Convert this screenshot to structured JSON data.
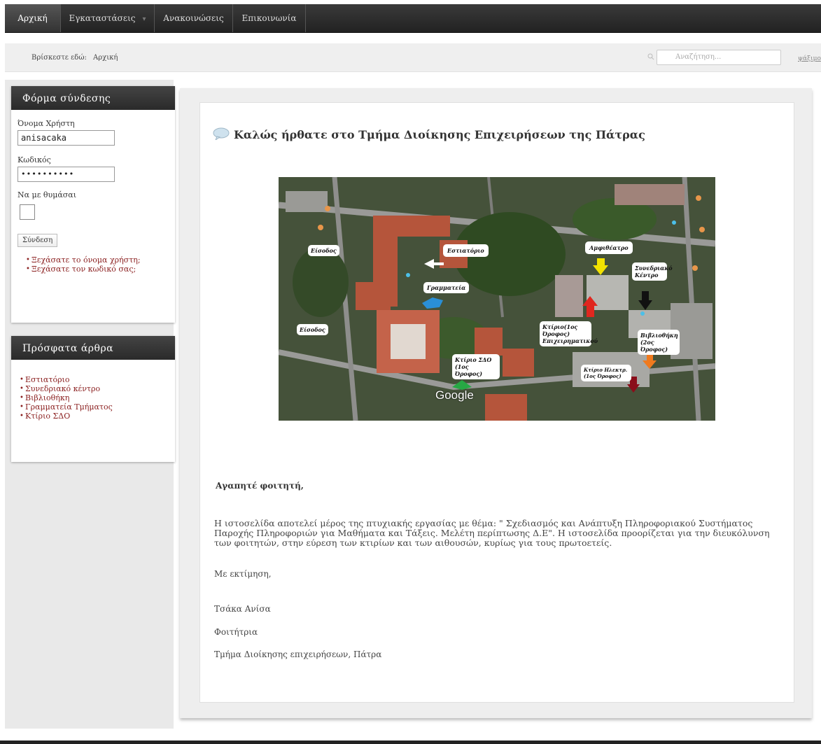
{
  "nav": {
    "items": [
      {
        "label": "Αρχική"
      },
      {
        "label": "Εγκαταστάσεις"
      },
      {
        "label": "Ανακοινώσεις"
      },
      {
        "label": "Επικοινωνία"
      }
    ]
  },
  "breadcrumb": {
    "prefix": "Βρίσκεστε εδώ:",
    "current": "Αρχική"
  },
  "search": {
    "placeholder": "Αναζήτηση...",
    "button_label": "ψάξιμο"
  },
  "login": {
    "title": "Φόρμα σύνδεσης",
    "username_label": "Όνομα Χρήστη",
    "username_value": "anisacaka",
    "password_label": "Κωδικός",
    "password_value": "••••••••••",
    "remember_label": "Να με θυμάσαι",
    "submit_label": "Σύνδεση",
    "links": [
      "Ξεχάσατε το όνομα χρήστη;",
      "Ξεχάσατε τον κωδικό σας;"
    ]
  },
  "recent": {
    "title": "Πρόσφατα άρθρα",
    "items": [
      "Εστιατόριο",
      "Συνεδριακό κέντρο",
      "Βιβλιοθήκη",
      "Γραμματεία Τμήματος",
      "Κτίριο ΣΔΟ"
    ]
  },
  "article": {
    "title": "Καλώς ήρθατε στο Τμήμα Διοίκησης Επιχειρήσεων της Πάτρας",
    "greeting": "Αγαπητέ φοιτητή,",
    "paragraph": "Η ιστοσελίδα αποτελεί μέρος της πτυχιακής εργασίας με θέμα: \" Σχεδιασμός και Ανάπτυξη Πληροφοριακού Συστήματος Παροχής Πληροφοριών για Μαθήματα και Τάξεις. Μελέτη περίπτωσης Δ.Ε\". Η ιστοσελίδα προορίζεται για την διευκόλυνση των φοιτητών, στην εύρεση των κτιρίων και των αιθουσών, κυρίως για τους πρωτοετείς.",
    "closing": "Με εκτίμηση,",
    "signature_name": "Τσάκα Ανίσα",
    "signature_role": "Φοιτήτρια",
    "signature_dept": "Τμήμα Διοίκησης επιχειρήσεων, Πάτρα"
  },
  "map": {
    "labels": {
      "entrance1": "Είσοδος",
      "restaurant": "Εστιατόριο",
      "amphitheatre": "Αμφιθέατρο",
      "conference": "Συνεδριακό Κέντρο",
      "secretariat": "Γραμματεία",
      "entrance2": "Είσοδος",
      "business_building": "Κτίριο(1ος Όροφος) Επιχειρηματικού",
      "library": "Βιβλιοθήκη (2ος Όροφος)",
      "sdo_building": "Κτίριο ΣΔΟ (1ος Όροφος)",
      "electrical_building": "Κτίριο Ηλεκτρ. (1ος Όροφος)"
    },
    "watermark": "Google",
    "colors": {
      "arrow_white": "#ffffff",
      "arrow_yellow": "#f2e200",
      "arrow_red": "#e0271f",
      "arrow_black": "#111111",
      "arrow_blue": "#2a8fd6",
      "arrow_orange": "#f07a1e",
      "arrow_green": "#27a844",
      "arrow_darkred": "#8a0d1a"
    }
  }
}
